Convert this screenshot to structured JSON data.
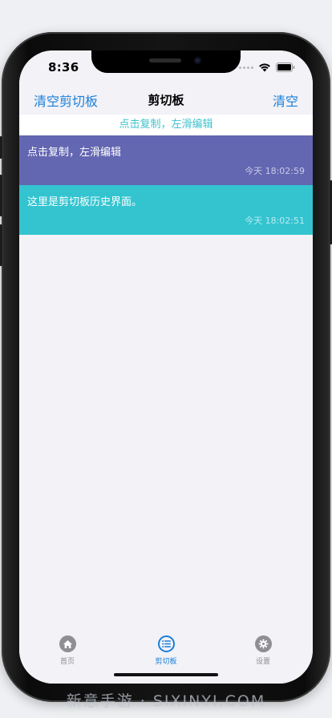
{
  "status_bar": {
    "time": "8:36"
  },
  "nav": {
    "left_button": "清空剪切板",
    "title": "剪切板",
    "right_button": "清空"
  },
  "hint": "点击复制，左滑编辑",
  "clips": [
    {
      "text": "点击复制，左滑编辑",
      "time": "今天 18:02:59",
      "color": "#6366b1"
    },
    {
      "text": "这里是剪切板历史界面。",
      "time": "今天 18:02:51",
      "color": "#33c4d0"
    }
  ],
  "tabs": [
    {
      "label": "首页",
      "icon": "home-icon",
      "active": false
    },
    {
      "label": "剪切板",
      "icon": "list-icon",
      "active": true
    },
    {
      "label": "设置",
      "icon": "gear-icon",
      "active": false
    }
  ],
  "colors": {
    "accent": "#1a7fd8",
    "hint": "#3fc2cc",
    "inactive_tab": "#8e8e93"
  },
  "watermark": "新意手游 · SIXINYI.COM"
}
